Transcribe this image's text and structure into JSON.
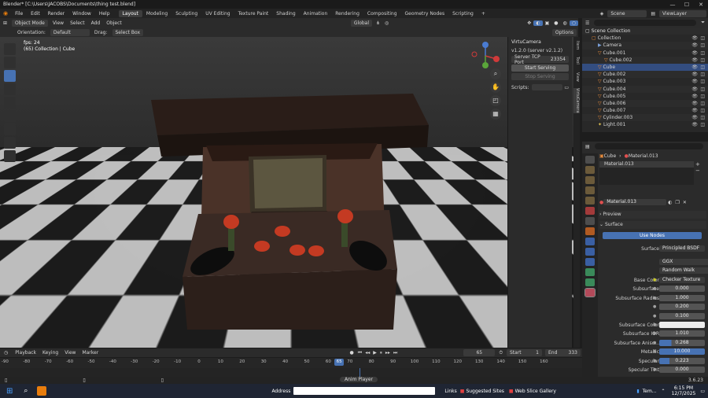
{
  "window": {
    "title": "Blender* [C:\\Users\\JACOBS\\Documents\\thing test.blend]",
    "min": "—",
    "max": "☐",
    "close": "✕"
  },
  "topbar": {
    "menus": [
      "File",
      "Edit",
      "Render",
      "Window",
      "Help"
    ],
    "workspaces": [
      "Layout",
      "Modeling",
      "Sculpting",
      "UV Editing",
      "Texture Paint",
      "Shading",
      "Animation",
      "Rendering",
      "Compositing",
      "Geometry Nodes",
      "Scripting",
      "+"
    ],
    "active_workspace": "Layout",
    "scene": "Scene",
    "view_layer": "ViewLayer"
  },
  "viewport_header": {
    "mode": "Object Mode",
    "menus": [
      "View",
      "Select",
      "Add",
      "Object"
    ],
    "transform": "Global",
    "orientation_label": "Orientation:",
    "orientation_value": "Default",
    "drag_label": "Drag:",
    "drag_value": "Select Box",
    "options": "Options"
  },
  "viewport": {
    "fps": "fps: 24",
    "info": "(65) Collection | Cube",
    "accent": "#4772b3"
  },
  "npanel": {
    "header": "VirtuCamera",
    "version": "v1.2.0 (server v2.1.2)",
    "server_port_label": "Server TCP Port",
    "server_port_value": "23354",
    "start": "Start Serving",
    "stop": "Stop Serving",
    "scripts_label": "Scripts:",
    "tabs": [
      "Item",
      "Tool",
      "View",
      "VirtuCamera"
    ]
  },
  "outliner": {
    "title": "Scene Collection",
    "rows": [
      {
        "name": "Collection",
        "indent": 1
      },
      {
        "name": "Camera",
        "indent": 2
      },
      {
        "name": "Cube.001",
        "indent": 2
      },
      {
        "name": "Cube.002",
        "indent": 3
      },
      {
        "name": "Cube",
        "indent": 2,
        "selected": true
      },
      {
        "name": "Cube.002",
        "indent": 2
      },
      {
        "name": "Cube.003",
        "indent": 2
      },
      {
        "name": "Cube.004",
        "indent": 2
      },
      {
        "name": "Cube.005",
        "indent": 2
      },
      {
        "name": "Cube.006",
        "indent": 2
      },
      {
        "name": "Cube.007",
        "indent": 2
      },
      {
        "name": "Cylinder.003",
        "indent": 2
      },
      {
        "name": "Light.001",
        "indent": 2
      }
    ]
  },
  "properties": {
    "breadcrumb_object": "Cube",
    "breadcrumb_material": "Material.013",
    "slot": "Material.013",
    "material_name": "Material.013",
    "preview": "Preview",
    "surface_panel": "Surface",
    "use_nodes": "Use Nodes",
    "surface_label": "Surface",
    "surface_value": "Principled BSDF",
    "distribution": "GGX",
    "subsurface_method": "Random Walk",
    "fields": [
      {
        "label": "Base Color",
        "value": "Checker Texture",
        "kind": "link"
      },
      {
        "label": "Subsurface",
        "value": "0.000",
        "fill": 0
      },
      {
        "label": "Subsurface Radius",
        "value": "1.000",
        "fill": 0
      },
      {
        "label": "",
        "value": "0.200",
        "fill": 0
      },
      {
        "label": "",
        "value": "0.100",
        "fill": 0
      },
      {
        "label": "Subsurface Color",
        "value": "",
        "kind": "color"
      },
      {
        "label": "Subsurface IOR",
        "value": "1.010",
        "fill": 0
      },
      {
        "label": "Subsurface Aniso...",
        "value": "0.268",
        "fill": 0.268
      },
      {
        "label": "Metallic",
        "value": "10.000",
        "fill": 1
      },
      {
        "label": "Specular",
        "value": "0.223",
        "fill": 0.223
      },
      {
        "label": "Specular Tint",
        "value": "0.000",
        "fill": 0
      }
    ],
    "version": "3.6.23"
  },
  "timeline": {
    "menus": [
      "Playback",
      "Keying",
      "View",
      "Marker"
    ],
    "current_frame": "65",
    "start_label": "Start",
    "start": "1",
    "end_label": "End",
    "end": "333",
    "ticks": [
      "-90",
      "-80",
      "-70",
      "-60",
      "-50",
      "-40",
      "-30",
      "-20",
      "-10",
      "0",
      "10",
      "20",
      "30",
      "40",
      "50",
      "60",
      "65",
      "70",
      "80",
      "90",
      "100",
      "110",
      "120",
      "130",
      "140",
      "150",
      "160"
    ],
    "playhead": "65",
    "status_center": "Anim Player"
  },
  "taskbar": {
    "address_label": "Address",
    "links_label": "Links",
    "suggested": "Suggested Sites",
    "webslice": "Web Slice Gallery",
    "weather": "Tem...",
    "time": "6:15 PM",
    "date": "12/7/2025"
  }
}
